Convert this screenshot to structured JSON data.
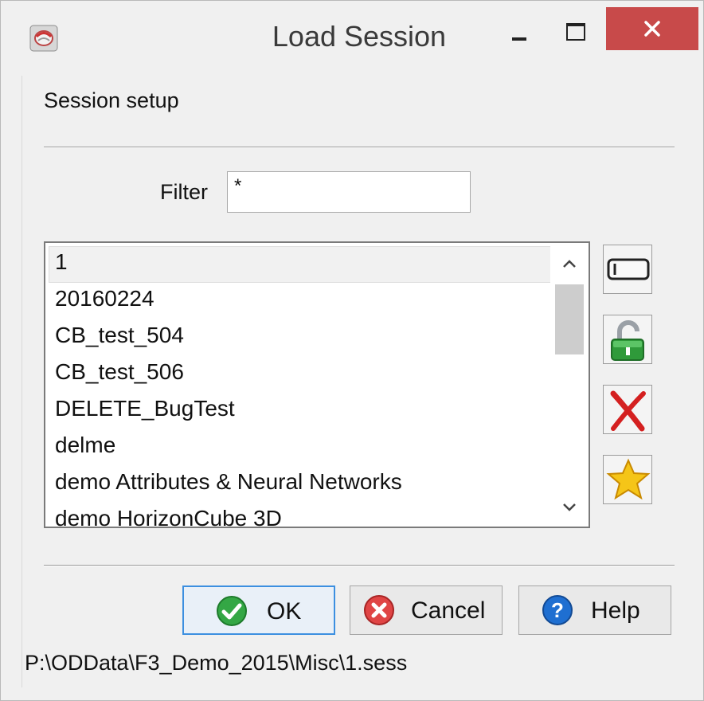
{
  "window": {
    "title": "Load Session",
    "icon": "opendtect-app-icon",
    "controls": [
      "minimize-icon",
      "maximize-icon",
      "close-icon"
    ],
    "close_color": "#c84a4a"
  },
  "section": {
    "label": "Session setup"
  },
  "filter": {
    "label": "Filter",
    "value": "*"
  },
  "sessions": {
    "items": [
      "1",
      "20160224",
      "CB_test_504",
      "CB_test_506",
      "DELETE_BugTest",
      "delme",
      "demo Attributes & Neural Networks",
      "demo HorizonCube 3D"
    ],
    "selected": "1"
  },
  "side_buttons": [
    "rename-icon",
    "unlock-icon",
    "delete-icon",
    "set-default-star-icon"
  ],
  "buttons": {
    "ok": "OK",
    "cancel": "Cancel",
    "help": "Help"
  },
  "status": {
    "path": "P:\\ODData\\F3_Demo_2015\\Misc\\1.sess"
  }
}
